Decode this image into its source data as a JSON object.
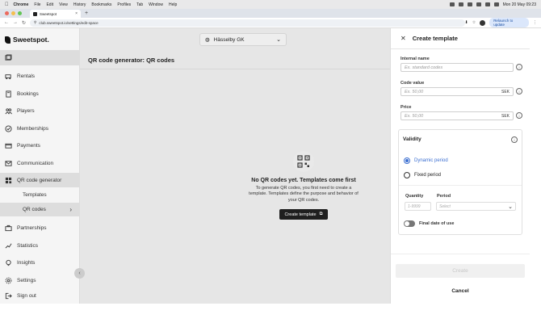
{
  "macos": {
    "app": "Chrome",
    "menus": [
      "File",
      "Edit",
      "View",
      "History",
      "Bookmarks",
      "Profiles",
      "Tab",
      "Window",
      "Help"
    ],
    "datetime": "Mon 20 May 09:23"
  },
  "browser": {
    "tab_title": "Sweetspot",
    "url": "club.sweetspot.io/settings/edit-space",
    "relaunch_label": "Relaunch to update"
  },
  "app": {
    "logo_text": "Sweetspot.",
    "club_name": "Hässelby GK",
    "page_title": "QR code generator: QR codes",
    "sidebar": {
      "items": [
        {
          "label": "Rentals",
          "icon": "golf-cart-icon"
        },
        {
          "label": "Bookings",
          "icon": "book-icon"
        },
        {
          "label": "Players",
          "icon": "players-icon"
        },
        {
          "label": "Memberships",
          "icon": "badge-icon"
        },
        {
          "label": "Payments",
          "icon": "payment-icon"
        },
        {
          "label": "Communication",
          "icon": "mail-icon"
        },
        {
          "label": "QR code generator",
          "icon": "qr-icon"
        }
      ],
      "sub_items": [
        {
          "label": "Templates"
        },
        {
          "label": "QR codes"
        }
      ],
      "bottom_items": [
        {
          "label": "Partnerships",
          "icon": "partnership-icon"
        },
        {
          "label": "Statistics",
          "icon": "statistics-icon"
        },
        {
          "label": "Insights",
          "icon": "insights-icon"
        },
        {
          "label": "Settings",
          "icon": "settings-icon"
        },
        {
          "label": "Sign out",
          "icon": "sign-out-icon"
        }
      ]
    },
    "empty_state": {
      "title": "No QR codes yet. Templates come first",
      "description": "To generate QR codes, you first need to create a template. Templates define the purpose and behavior of your QR codes.",
      "button_label": "Create template"
    }
  },
  "drawer": {
    "title": "Create template",
    "internal_name": {
      "label": "Internal name",
      "placeholder": "Ex. standard codes"
    },
    "code_value": {
      "label": "Code value",
      "placeholder": "Ex. 50,00",
      "suffix": "SEK"
    },
    "price": {
      "label": "Price",
      "placeholder": "Ex. 50,00",
      "suffix": "SEK"
    },
    "validity": {
      "title": "Validity",
      "options": [
        "Dynamic period",
        "Fixed period"
      ],
      "selected": "Dynamic period",
      "quantity_label": "Quantity",
      "quantity_placeholder": "1-9999",
      "period_label": "Period",
      "period_placeholder": "Select",
      "final_date_label": "Final date of use",
      "final_date_enabled": false
    },
    "submit_label": "Create",
    "cancel_label": "Cancel"
  },
  "colors": {
    "accent": "#3c6fd1",
    "primary_button": "#1f1f1f",
    "overlay": "#e6e6e6"
  }
}
